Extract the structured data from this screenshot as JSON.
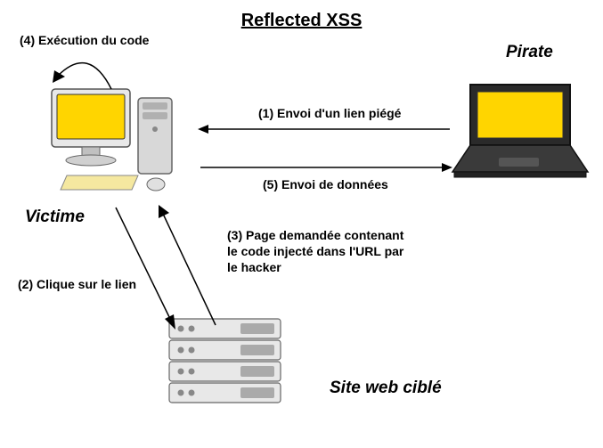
{
  "title": "Reflected XSS",
  "nodes": {
    "victim": "Victime",
    "pirate": "Pirate",
    "server": "Site web ciblé"
  },
  "steps": {
    "s1": "(1) Envoi d'un lien piégé",
    "s2": "(2) Clique sur le lien",
    "s3": "(3) Page demandée contenant le code injecté dans l'URL par le hacker",
    "s4": "(4) Exécution du code",
    "s5": "(5) Envoi de données"
  }
}
